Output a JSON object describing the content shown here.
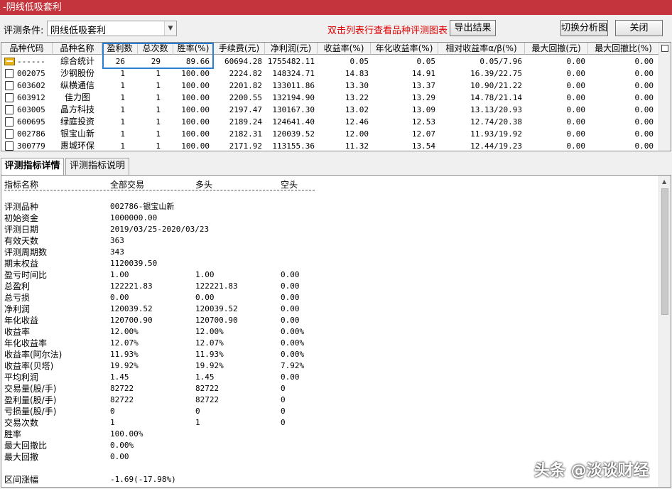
{
  "window": {
    "title": "-阴线低吸套利"
  },
  "toolbar": {
    "condition_label": "评测条件:",
    "condition_value": "阴线低吸套利",
    "hint": "双击列表行查看品种评测图表",
    "export_button": "导出结果",
    "switch_button": "切换分析图",
    "close_button": "关闭"
  },
  "grid": {
    "columns": [
      "品种代码",
      "品种名称",
      "盈利数",
      "总次数",
      "胜率(%)",
      "手续费(元)",
      "净利润(元)",
      "收益率(%)",
      "年化收益率(%)",
      "相对收益率α/β(%)",
      "最大回撤(元)",
      "最大回撤比(%)"
    ],
    "summary": {
      "code": "------",
      "name": "综合统计",
      "wins": "26",
      "total": "29",
      "winrate": "89.66",
      "fee": "60694.28",
      "profit": "1755482.11",
      "ret": "0.05",
      "annual": "0.05",
      "rel": "0.05/7.96",
      "dd": "0.00",
      "ddr": "0.00"
    },
    "rows": [
      {
        "code": "002075",
        "name": "沙钢股份",
        "wins": "1",
        "total": "1",
        "winrate": "100.00",
        "fee": "2224.82",
        "profit": "148324.71",
        "ret": "14.83",
        "annual": "14.91",
        "rel": "16.39/22.75",
        "dd": "0.00",
        "ddr": "0.00"
      },
      {
        "code": "603602",
        "name": "纵横通信",
        "wins": "1",
        "total": "1",
        "winrate": "100.00",
        "fee": "2201.82",
        "profit": "133011.86",
        "ret": "13.30",
        "annual": "13.37",
        "rel": "10.90/21.22",
        "dd": "0.00",
        "ddr": "0.00"
      },
      {
        "code": "603912",
        "name": "佳力图",
        "wins": "1",
        "total": "1",
        "winrate": "100.00",
        "fee": "2200.55",
        "profit": "132194.90",
        "ret": "13.22",
        "annual": "13.29",
        "rel": "14.78/21.14",
        "dd": "0.00",
        "ddr": "0.00"
      },
      {
        "code": "603005",
        "name": "晶方科技",
        "wins": "1",
        "total": "1",
        "winrate": "100.00",
        "fee": "2197.47",
        "profit": "130167.30",
        "ret": "13.02",
        "annual": "13.09",
        "rel": "13.13/20.93",
        "dd": "0.00",
        "ddr": "0.00"
      },
      {
        "code": "600695",
        "name": "绿庭投资",
        "wins": "1",
        "total": "1",
        "winrate": "100.00",
        "fee": "2189.24",
        "profit": "124641.40",
        "ret": "12.46",
        "annual": "12.53",
        "rel": "12.74/20.38",
        "dd": "0.00",
        "ddr": "0.00"
      },
      {
        "code": "002786",
        "name": "银宝山新",
        "wins": "1",
        "total": "1",
        "winrate": "100.00",
        "fee": "2182.31",
        "profit": "120039.52",
        "ret": "12.00",
        "annual": "12.07",
        "rel": "11.93/19.92",
        "dd": "0.00",
        "ddr": "0.00"
      },
      {
        "code": "300779",
        "name": "惠城环保",
        "wins": "1",
        "total": "1",
        "winrate": "100.00",
        "fee": "2171.92",
        "profit": "113155.36",
        "ret": "11.32",
        "annual": "13.54",
        "rel": "12.44/19.23",
        "dd": "0.00",
        "ddr": "0.00"
      }
    ]
  },
  "tabs": [
    {
      "label": "评测指标详情",
      "active": true
    },
    {
      "label": "评测指标说明",
      "active": false
    }
  ],
  "detail": {
    "headers": [
      "指标名称",
      "全部交易",
      "多头",
      "空头"
    ],
    "rows": [
      [
        "评测品种",
        "002786-银宝山新",
        "",
        ""
      ],
      [
        "初始资金",
        "1000000.00",
        "",
        ""
      ],
      [
        "评测日期",
        "2019/03/25-2020/03/23",
        "",
        ""
      ],
      [
        "有效天数",
        "363",
        "",
        ""
      ],
      [
        "评测周期数",
        "343",
        "",
        ""
      ],
      [
        "期末权益",
        "1120039.50",
        "",
        ""
      ],
      [
        "盈亏时间比",
        "1.00",
        "1.00",
        "0.00"
      ],
      [
        "总盈利",
        "122221.83",
        "122221.83",
        "0.00"
      ],
      [
        "总亏损",
        "0.00",
        "0.00",
        "0.00"
      ],
      [
        "净利润",
        "120039.52",
        "120039.52",
        "0.00"
      ],
      [
        "年化收益",
        "120700.90",
        "120700.90",
        "0.00"
      ],
      [
        "收益率",
        "12.00%",
        "12.00%",
        "0.00%"
      ],
      [
        "年化收益率",
        "12.07%",
        "12.07%",
        "0.00%"
      ],
      [
        "收益率(阿尔法)",
        "11.93%",
        "11.93%",
        "0.00%"
      ],
      [
        "收益率(贝塔)",
        "19.92%",
        "19.92%",
        "7.92%"
      ],
      [
        "平均利润",
        "1.45",
        "1.45",
        "0.00"
      ],
      [
        "交易量(股/手)",
        "82722",
        "82722",
        "0"
      ],
      [
        "盈利量(股/手)",
        "82722",
        "82722",
        "0"
      ],
      [
        "亏损量(股/手)",
        "0",
        "0",
        "0"
      ],
      [
        "交易次数",
        "1",
        "1",
        "0"
      ],
      [
        "胜率",
        "100.00%",
        "",
        ""
      ],
      [
        "最大回撤比",
        "0.00%",
        "",
        ""
      ],
      [
        "最大回撤",
        "0.00",
        "",
        ""
      ],
      [
        "",
        "",
        "",
        ""
      ],
      [
        "区间涨幅",
        "-1.69(-17.98%)",
        "",
        ""
      ]
    ]
  },
  "watermark": "头条 @淡谈财经"
}
